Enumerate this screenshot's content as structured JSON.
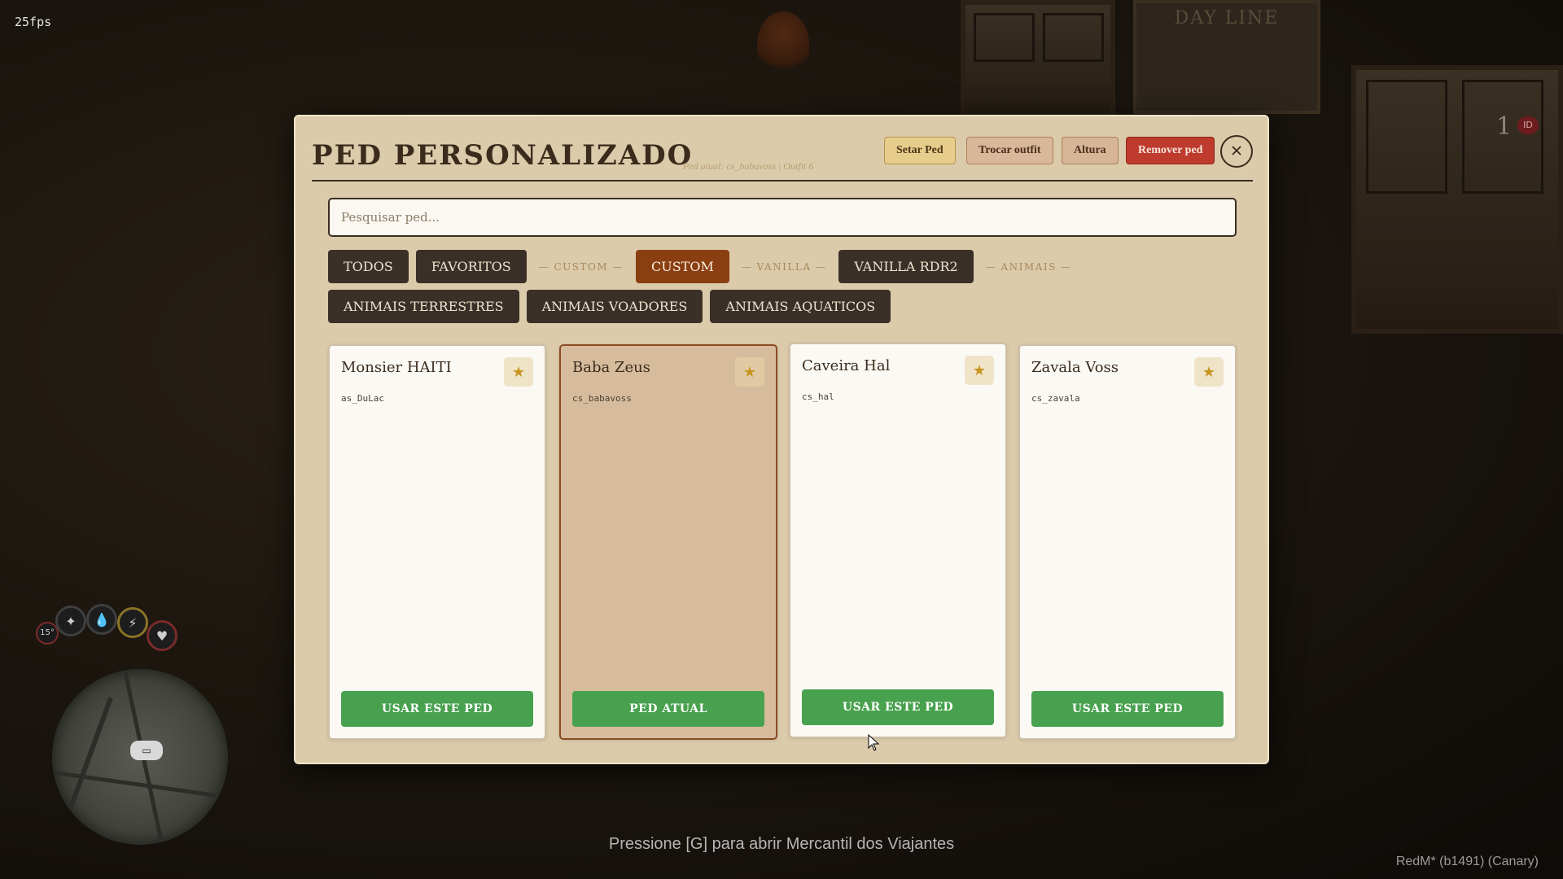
{
  "hud": {
    "fps": "25fps",
    "players": "1",
    "player_badge": "ID",
    "temperature": "15°",
    "interaction_prompt": "Pressione [G] para abrir Mercantil dos Viajantes",
    "build": "RedM* (b1491) (Canary)"
  },
  "background": {
    "sign_text": "DAY LINE"
  },
  "modal": {
    "title": "PED PERSONALIZADO",
    "current_ped": "Ped atual: cs_babavoss | Outfit 6",
    "buttons": {
      "setar": "Setar Ped",
      "trocar": "Trocar outfit",
      "altura": "Altura",
      "remover": "Remover ped"
    },
    "search_placeholder": "Pesquisar ped...",
    "tabs_row1": [
      "TODOS",
      "FAVORITOS"
    ],
    "separators": [
      "— CUSTOM —",
      "— VANILLA —",
      "— ANIMAIS —"
    ],
    "tab_custom": "CUSTOM",
    "tab_vanilla": "VANILLA RDR2",
    "tabs_row2": [
      "ANIMAIS TERRESTRES",
      "ANIMAIS VOADORES",
      "ANIMAIS AQUATICOS"
    ],
    "active_tab": "CUSTOM",
    "cards": [
      {
        "name": "Monsier HAITI",
        "code": "as_DuLac",
        "button": "USAR ESTE PED",
        "current": false
      },
      {
        "name": "Baba Zeus",
        "code": "cs_babavoss",
        "button": "PED ATUAL",
        "current": true
      },
      {
        "name": "Caveira Hal",
        "code": "cs_hal",
        "button": "USAR ESTE PED",
        "current": false
      },
      {
        "name": "Zavala Voss",
        "code": "cs_zavala",
        "button": "USAR ESTE PED",
        "current": false
      }
    ]
  },
  "colors": {
    "modal_bg": "#dccbab",
    "accent_active_tab": "#8a3e12",
    "use_button": "#48a14e",
    "remove_button": "#bf3b2d"
  },
  "icons": [
    "close-icon",
    "star-icon",
    "cursor-icon"
  ]
}
